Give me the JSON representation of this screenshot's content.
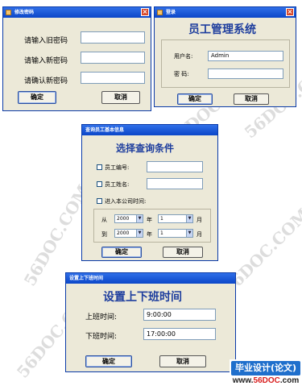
{
  "watermark": "56DOC.COM",
  "change_password": {
    "title": "修改密码",
    "old_label": "请输入旧密码",
    "new_label": "请输入新密码",
    "confirm_label": "请确认新密码",
    "ok": "确定",
    "cancel": "取消"
  },
  "login": {
    "title": "登录",
    "heading": "员工管理系统",
    "username_label": "用户名:",
    "username_value": "Admin",
    "password_label": "密 码:",
    "ok": "确定",
    "cancel": "取消"
  },
  "query": {
    "title": "查询员工基本信息",
    "heading": "选择查询条件",
    "emp_no_label": "员工编号:",
    "emp_name_label": "员工姓名:",
    "join_date_label": "进入本公司时间:",
    "from_label": "从",
    "to_label": "到",
    "year_from": "2000",
    "month_from": "1",
    "year_to": "2000",
    "month_to": "1",
    "year_unit": "年",
    "month_unit": "月",
    "ok": "确定",
    "cancel": "取消"
  },
  "worktime": {
    "title": "设置上下班时间",
    "heading": "设置上下班时间",
    "start_label": "上班时间:",
    "start_value": "9:00:00",
    "end_label": "下班时间:",
    "end_value": "17:00:00",
    "ok": "确定",
    "cancel": "取消"
  },
  "footer": {
    "line1": "毕业设计(论文)网",
    "line2_prefix": "www.",
    "line2_brand": "56DOC",
    "line2_suffix": ".com"
  }
}
